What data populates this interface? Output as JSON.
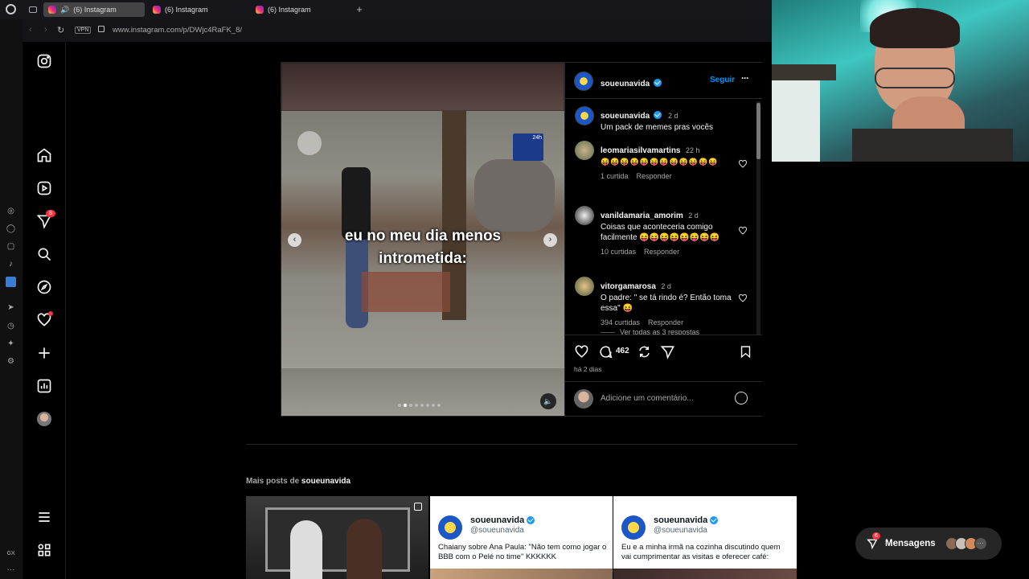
{
  "browser": {
    "tabs": [
      {
        "title": "(6) Instagram",
        "active": true
      },
      {
        "title": "(6) Instagram",
        "active": false
      },
      {
        "title": "(6) Instagram",
        "active": false
      }
    ],
    "vpn_label": "VPN",
    "url": "www.instagram.com/p/DWjc4RaFK_8/",
    "gx_label": "GX"
  },
  "nav": {
    "notifications_badge": "8"
  },
  "post": {
    "author": "soueunavida",
    "follow_label": "Seguir",
    "caption_author": "soueunavida",
    "caption_time": "2 d",
    "caption_text": "Um pack de memes pras vocês",
    "overlay_text_line1": "eu no meu dia menos",
    "overlay_text_line2": "intrometida:",
    "channel_logo": "24h",
    "comments": [
      {
        "user": "leomariasilvamartins",
        "time": "22 h",
        "text": "😝😝😝😝😝😝😝😝😝😝😝😝",
        "likes": "1 curtida",
        "reply": "Responder"
      },
      {
        "user": "vanildamaria_amorim",
        "time": "2 d",
        "text": "Coisas que aconteceria comigo facilmente 😝😝😝😝😝😝😝😝",
        "likes": "10 curtidas",
        "reply": "Responder"
      },
      {
        "user": "vitorgamarosa",
        "time": "2 d",
        "text": "O padre: \" se tá rindo é? Então toma essa\" 😝",
        "likes": "394 curtidas",
        "reply": "Responder"
      }
    ],
    "view_replies": "Ver todas as 3 respostas",
    "comment_count": "462",
    "posted_ago": "há 2 dias",
    "add_comment_placeholder": "Adicione um comentário..."
  },
  "more_posts": {
    "label_prefix": "Mais posts de",
    "label_user": "soueunavida",
    "cards": [
      {
        "name": "soueunavida",
        "handle": "@soueunavida",
        "text": "Chaiany sobre Ana Paula: \"Não tem como jogar o BBB com o Pelé no time\" KKKKKK"
      },
      {
        "name": "soueunavida",
        "handle": "@soueunavida",
        "text": "Eu e a minha irmã na cozinha discutindo quem vai cumprimentar as visitas e oferecer café:"
      }
    ]
  },
  "messages": {
    "label": "Mensagens",
    "badge": "6"
  },
  "colors": {
    "accent": "#0095f6",
    "badge": "#ff3040",
    "verified": "#1d9bf0"
  }
}
